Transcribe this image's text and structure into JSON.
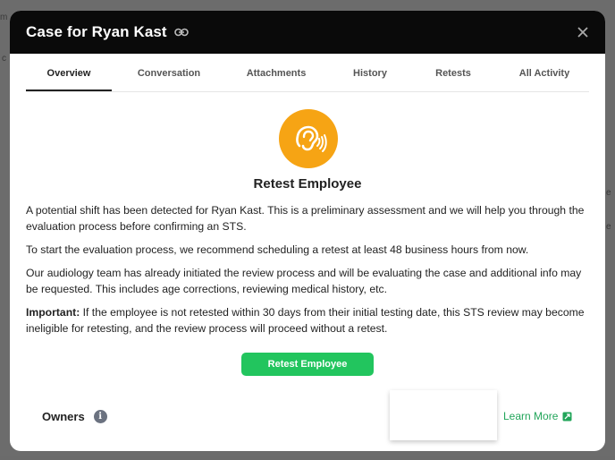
{
  "modal": {
    "title": "Case for Ryan Kast",
    "tabs": [
      "Overview",
      "Conversation",
      "Attachments",
      "History",
      "Retests",
      "All Activity"
    ],
    "active_tab": "Overview"
  },
  "hero": {
    "icon": "ear-icon",
    "title": "Retest Employee",
    "icon_color": "#f6a414"
  },
  "body": {
    "p1": "A potential shift has been detected for Ryan Kast. This is a preliminary assessment and we will help you through the evaluation process before confirming an STS.",
    "p2": "To start the evaluation process, we recommend scheduling a retest at least 48 business hours from now.",
    "p3": "Our audiology team has already initiated the review process and will be evaluating the case and additional info may be requested. This includes age corrections, reviewing medical history, etc.",
    "p4_label": "Important:",
    "p4_text": " If the employee is not retested within 30 days from their initial testing date, this STS review may become ineligible for retesting, and the review process will proceed without a retest."
  },
  "actions": {
    "retest_button": "Retest Employee",
    "button_color": "#22c55e"
  },
  "footer": {
    "owners_label": "Owners",
    "info_icon": "i",
    "learn_more": "Learn More"
  }
}
